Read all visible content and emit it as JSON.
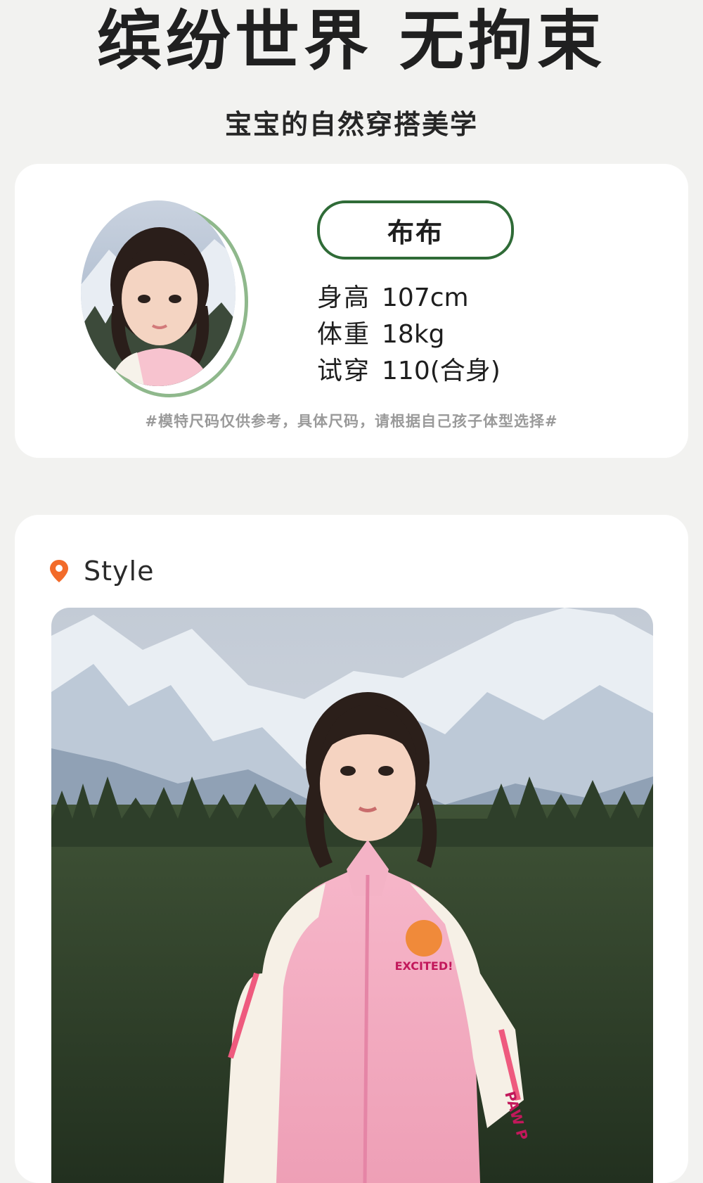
{
  "hero": {
    "title": "缤纷世界 无拘束",
    "subtitle": "宝宝的自然穿搭美学"
  },
  "model": {
    "name": "布布",
    "stats": [
      {
        "label": "身高",
        "value": "107cm"
      },
      {
        "label": "体重",
        "value": "18kg"
      },
      {
        "label": "试穿",
        "value": "110(合身)"
      }
    ],
    "note": "#模特尺码仅供参考，具体尺码，请根据自己孩子体型选择#"
  },
  "style": {
    "label": "Style",
    "icon": "location-pin-icon"
  },
  "photo": {
    "jacket_badge_text": "EXCITED!",
    "sleeve_text": "PAW P"
  },
  "colors": {
    "accent_green": "#2f6b37",
    "ring_green": "#8fb88c",
    "pin_orange": "#f26b2a",
    "jacket_pink": "#f4a9c0"
  }
}
